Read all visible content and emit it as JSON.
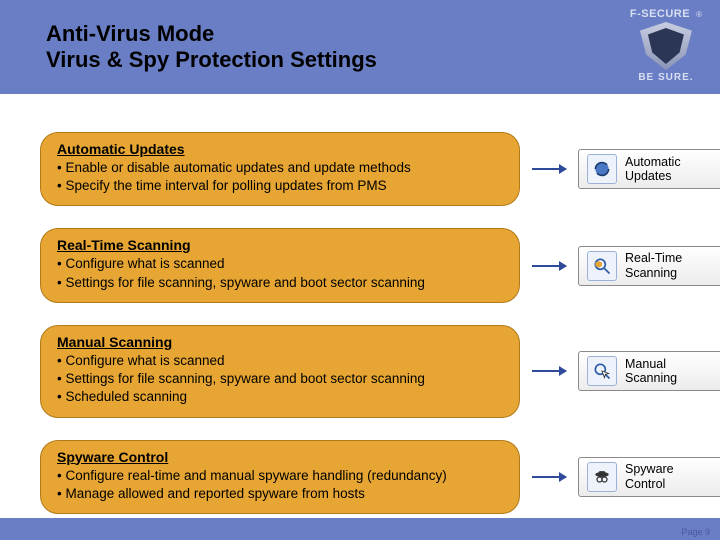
{
  "header": {
    "line1": "Anti-Virus Mode",
    "line2": "Virus & Spy Protection Settings"
  },
  "brand": {
    "name": "F-SECURE",
    "reg": "®",
    "tagline": "BE SURE."
  },
  "sections": [
    {
      "title": "Automatic Updates",
      "bullets": [
        "• Enable or disable automatic updates and update methods",
        "• Specify the time interval for polling updates from PMS"
      ],
      "tile_label": "Automatic\nUpdates"
    },
    {
      "title": "Real-Time Scanning",
      "bullets": [
        "• Configure what is scanned",
        "• Settings for file scanning, spyware and boot sector scanning"
      ],
      "tile_label": "Real-Time\nScanning"
    },
    {
      "title": "Manual Scanning",
      "bullets": [
        "• Configure what is scanned",
        "• Settings for file scanning, spyware and boot sector scanning",
        "• Scheduled scanning"
      ],
      "tile_label": "Manual\nScanning"
    },
    {
      "title": "Spyware Control",
      "bullets": [
        "• Configure real-time and manual spyware handling (redundancy)",
        "• Manage allowed and reported spyware from hosts"
      ],
      "tile_label": "Spyware\nControl"
    }
  ],
  "footer": {
    "page": "Page 9"
  }
}
